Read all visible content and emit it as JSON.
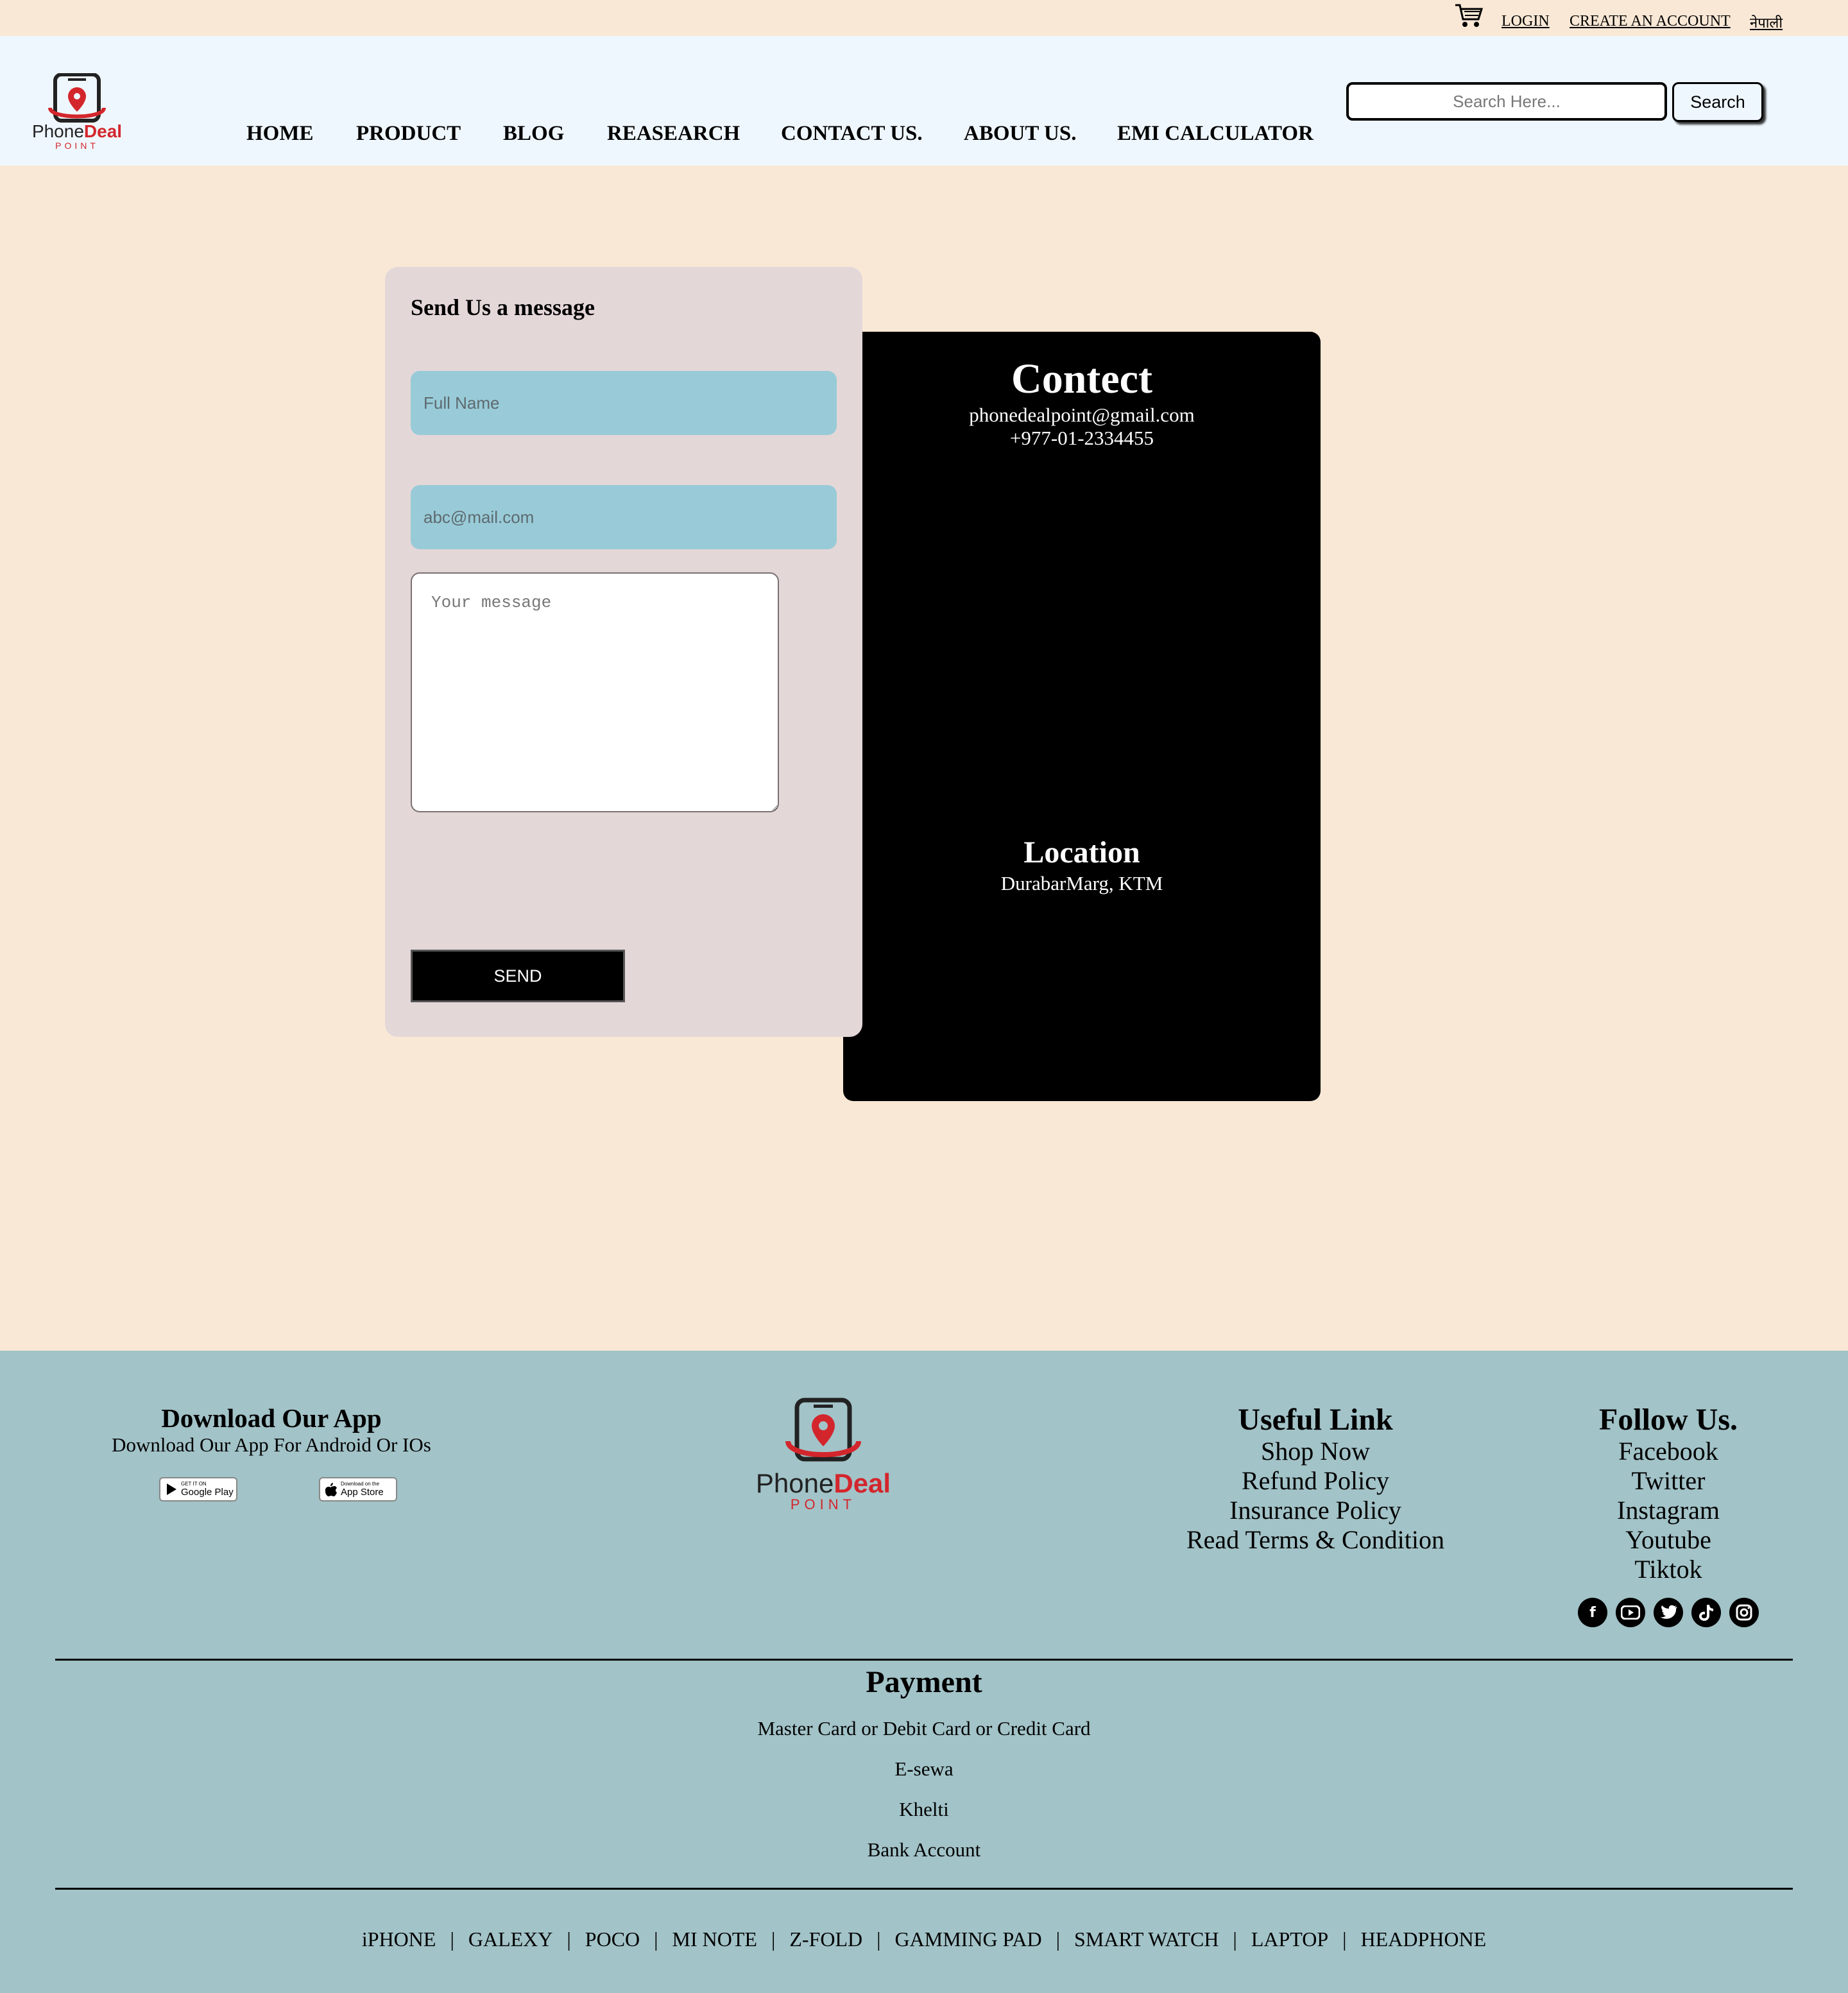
{
  "topbar": {
    "login": "LOGIN",
    "create_account": "CREATE AN ACCOUNT",
    "language": "नेपाली"
  },
  "brand": {
    "name_part1": "Phone",
    "name_part2": "Deal",
    "tagline": "POINT",
    "colors": {
      "dark": "#222222",
      "red": "#d3262c"
    }
  },
  "nav": {
    "items": [
      "HOME",
      "PRODUCT",
      "BLOG",
      "REASEARCH",
      "CONTACT US.",
      "ABOUT US.",
      "EMI CALCULATOR"
    ]
  },
  "search": {
    "placeholder": "Search Here...",
    "button_label": "Search"
  },
  "form": {
    "title": "Send Us a message",
    "name_placeholder": "Full Name",
    "email_placeholder": "abc@mail.com",
    "message_placeholder": "Your message",
    "send_label": "SEND"
  },
  "contact": {
    "title": "Contect",
    "email": "phonedealpoint@gmail.com",
    "phone": "+977-01-2334455",
    "location_title": "Location",
    "location": "DurabarMarg, KTM"
  },
  "footer": {
    "download": {
      "title": "Download Our App",
      "subtitle": "Download Our App For Android Or IOs",
      "google_small": "GET IT ON",
      "google_label": "Google Play",
      "apple_small": "Download on the",
      "apple_label": "App Store"
    },
    "useful": {
      "title": "Useful Link",
      "items": [
        "Shop Now",
        "Refund Policy",
        "Insurance Policy",
        "Read Terms & Condition"
      ]
    },
    "follow": {
      "title": "Follow Us.",
      "items": [
        "Facebook",
        "Twitter",
        "Instagram",
        "Youtube",
        "Tiktok"
      ],
      "icons": [
        "facebook-icon",
        "youtube-icon",
        "twitter-icon",
        "tiktok-icon",
        "instagram-icon"
      ]
    },
    "payment": {
      "title": "Payment",
      "items": [
        "Master Card or Debit Card or Credit Card",
        "E-sewa",
        "Khelti",
        "Bank Account"
      ]
    },
    "categories": [
      "iPHONE",
      "GALEXY",
      "POCO",
      "MI NOTE",
      "Z-FOLD",
      "GAMMING PAD",
      "SMART WATCH",
      "LAPTOP",
      "HEADPHONE"
    ],
    "separator": "|"
  },
  "colors": {
    "page_bg": "#f9e8d6",
    "header_bg": "#eff7fe",
    "form_bg": "#e4d7d8",
    "input_bg": "#98cbd7",
    "footer_bg": "#a2c3c8"
  }
}
